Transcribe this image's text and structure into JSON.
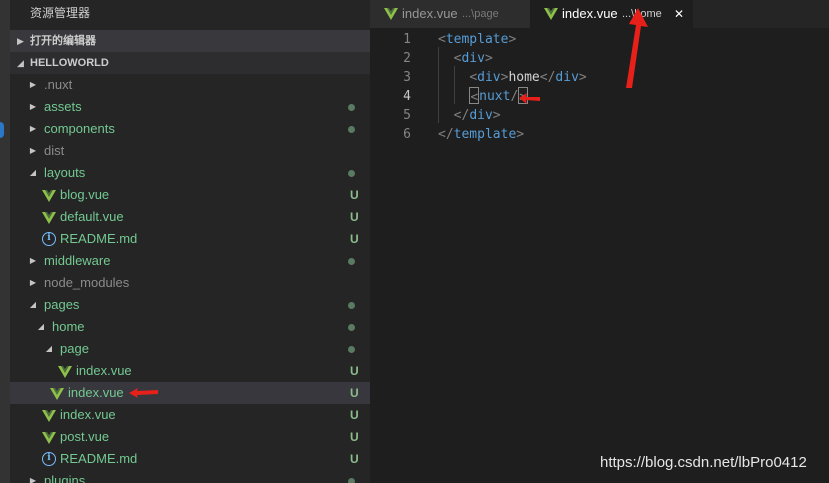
{
  "sidebar": {
    "title": "资源管理器",
    "open_editors_label": "打开的编辑器",
    "project_label": "HELLOWORLD",
    "rows": [
      {
        "label": "nuxt-row",
        "text": ".nuxt",
        "indent": 0,
        "kind": "folder",
        "open": false,
        "color": "dim",
        "status": ""
      },
      {
        "label": "assets-row",
        "text": "assets",
        "indent": 0,
        "kind": "folder",
        "open": false,
        "color": "green",
        "status": "dot"
      },
      {
        "label": "components-row",
        "text": "components",
        "indent": 0,
        "kind": "folder",
        "open": false,
        "color": "green",
        "status": "dot"
      },
      {
        "label": "dist-row",
        "text": "dist",
        "indent": 0,
        "kind": "folder",
        "open": false,
        "color": "dim",
        "status": ""
      },
      {
        "label": "layouts-row",
        "text": "layouts",
        "indent": 0,
        "kind": "folder",
        "open": true,
        "color": "green",
        "status": "dot"
      },
      {
        "label": "blog-vue-row",
        "text": "blog.vue",
        "indent": 1,
        "kind": "vue",
        "color": "green",
        "status": "U"
      },
      {
        "label": "default-vue-row",
        "text": "default.vue",
        "indent": 1,
        "kind": "vue",
        "color": "green",
        "status": "U"
      },
      {
        "label": "readme-row-1",
        "text": "README.md",
        "indent": 1,
        "kind": "info",
        "color": "green",
        "status": "U"
      },
      {
        "label": "middleware-row",
        "text": "middleware",
        "indent": 0,
        "kind": "folder",
        "open": false,
        "color": "green",
        "status": "dot"
      },
      {
        "label": "node-modules-row",
        "text": "node_modules",
        "indent": 0,
        "kind": "folder",
        "open": false,
        "color": "dim",
        "status": ""
      },
      {
        "label": "pages-row",
        "text": "pages",
        "indent": 0,
        "kind": "folder",
        "open": true,
        "color": "green",
        "status": "dot"
      },
      {
        "label": "home-row",
        "text": "home",
        "indent": 1,
        "kind": "folder",
        "open": true,
        "color": "green",
        "status": "dot"
      },
      {
        "label": "page-row",
        "text": "page",
        "indent": 2,
        "kind": "folder",
        "open": true,
        "color": "green",
        "status": "dot"
      },
      {
        "label": "page-index-vue-row",
        "text": "index.vue",
        "indent": 3,
        "kind": "vue",
        "color": "green",
        "status": "U"
      },
      {
        "label": "home-index-vue-row",
        "text": "index.vue",
        "indent": 2,
        "kind": "vue",
        "color": "green",
        "status": "U",
        "selected": true
      },
      {
        "label": "pages-index-vue-row",
        "text": "index.vue",
        "indent": 1,
        "kind": "vue",
        "color": "green",
        "status": "U"
      },
      {
        "label": "post-vue-row",
        "text": "post.vue",
        "indent": 1,
        "kind": "vue",
        "color": "green",
        "status": "U"
      },
      {
        "label": "readme-row-2",
        "text": "README.md",
        "indent": 1,
        "kind": "info",
        "color": "green",
        "status": "U"
      },
      {
        "label": "plugins-row",
        "text": "plugins",
        "indent": 0,
        "kind": "folder",
        "open": false,
        "color": "green",
        "status": "dot"
      }
    ]
  },
  "tabs": [
    {
      "name": "index.vue",
      "desc": "...\\page",
      "active": false
    },
    {
      "name": "index.vue",
      "desc": "...\\home",
      "active": true,
      "close": "✕"
    }
  ],
  "editor": {
    "active_line": 4,
    "lines": [
      {
        "n": "1",
        "tokens": [
          {
            "c": "br",
            "t": "<"
          },
          {
            "c": "tag",
            "t": "template"
          },
          {
            "c": "br",
            "t": ">"
          }
        ]
      },
      {
        "n": "2",
        "tokens": [
          {
            "c": "txt",
            "t": "  "
          },
          {
            "c": "br",
            "t": "<"
          },
          {
            "c": "tag",
            "t": "div"
          },
          {
            "c": "br",
            "t": ">"
          }
        ]
      },
      {
        "n": "3",
        "tokens": [
          {
            "c": "txt",
            "t": "    "
          },
          {
            "c": "br",
            "t": "<"
          },
          {
            "c": "tag",
            "t": "div"
          },
          {
            "c": "br",
            "t": ">"
          },
          {
            "c": "txt",
            "t": "home"
          },
          {
            "c": "br",
            "t": "</"
          },
          {
            "c": "tag",
            "t": "div"
          },
          {
            "c": "br",
            "t": ">"
          }
        ]
      },
      {
        "n": "4",
        "tokens": [
          {
            "c": "txt",
            "t": "    "
          },
          {
            "c": "boxbr",
            "t": "<"
          },
          {
            "c": "tag",
            "t": "nuxt"
          },
          {
            "c": "br",
            "t": "/"
          },
          {
            "c": "boxbr",
            "t": ">"
          }
        ]
      },
      {
        "n": "5",
        "tokens": [
          {
            "c": "txt",
            "t": "  "
          },
          {
            "c": "br",
            "t": "</"
          },
          {
            "c": "tag",
            "t": "div"
          },
          {
            "c": "br",
            "t": ">"
          }
        ]
      },
      {
        "n": "6",
        "tokens": [
          {
            "c": "br",
            "t": "</"
          },
          {
            "c": "tag",
            "t": "template"
          },
          {
            "c": "br",
            "t": ">"
          }
        ]
      }
    ]
  },
  "watermark": "https://blog.csdn.net/lbPro0412",
  "colors": {
    "accent_red": "#e8201a",
    "vue_green": "#8dc149",
    "git_untracked": "#73c991",
    "tag_blue": "#569cd6"
  }
}
